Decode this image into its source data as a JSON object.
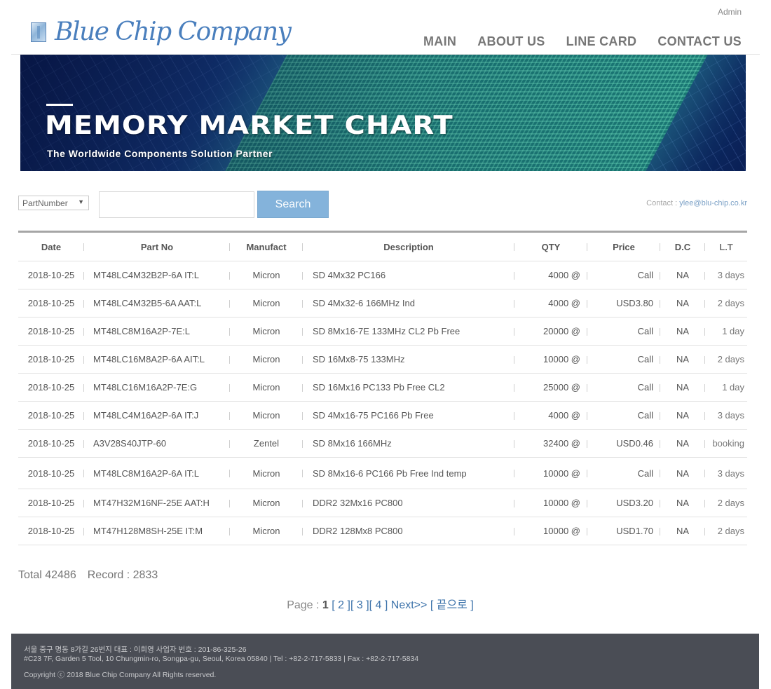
{
  "header": {
    "admin": "Admin",
    "logo_text": "Blue Chip Company",
    "nav": [
      "MAIN",
      "ABOUT US",
      "LINE CARD",
      "CONTACT US"
    ]
  },
  "banner": {
    "title": "MEMORY MARKET CHART",
    "subtitle": "The Worldwide Components Solution Partner"
  },
  "search": {
    "select_value": "PartNumber",
    "input_value": "",
    "button_label": "Search",
    "contact_label": "Contact : ",
    "contact_email": "ylee@blu-chip.co.kr"
  },
  "table": {
    "headers": [
      "Date",
      "Part No",
      "Manufact",
      "Description",
      "QTY",
      "Price",
      "D.C",
      "L.T"
    ],
    "rows": [
      [
        "2018-10-25",
        "MT48LC4M32B2P-6A IT:L",
        "Micron",
        "SD 4Mx32 PC166",
        "4000 @",
        "Call",
        "NA",
        "3 days"
      ],
      [
        "2018-10-25",
        "MT48LC4M32B5-6A AAT:L",
        "Micron",
        "SD 4Mx32-6 166MHz Ind",
        "4000 @",
        "USD3.80",
        "NA",
        "2 days"
      ],
      [
        "2018-10-25",
        "MT48LC8M16A2P-7E:L",
        "Micron",
        "SD 8Mx16-7E 133MHz CL2 Pb Free",
        "20000 @",
        "Call",
        "NA",
        "1 day"
      ],
      [
        "2018-10-25",
        "MT48LC16M8A2P-6A AIT:L",
        "Micron",
        "SD 16Mx8-75 133MHz",
        "10000 @",
        "Call",
        "NA",
        "2 days"
      ],
      [
        "2018-10-25",
        "MT48LC16M16A2P-7E:G",
        "Micron",
        "SD 16Mx16 PC133 Pb Free CL2",
        "25000 @",
        "Call",
        "NA",
        "1 day"
      ],
      [
        "2018-10-25",
        "MT48LC4M16A2P-6A IT:J",
        "Micron",
        "SD 4Mx16-75 PC166 Pb Free",
        "4000 @",
        "Call",
        "NA",
        "3 days"
      ],
      [
        "2018-10-25",
        "A3V28S40JTP-60",
        "Zentel",
        "SD 8Mx16 166MHz",
        "32400 @",
        "USD0.46",
        "NA",
        "booking"
      ],
      [
        "2018-10-25",
        "MT48LC8M16A2P-6A IT:L",
        "Micron",
        "SD 8Mx16-6 PC166 Pb Free Ind temp",
        "10000 @",
        "Call",
        "NA",
        "3 days"
      ],
      [
        "2018-10-25",
        "MT47H32M16NF-25E AAT:H",
        "Micron",
        "DDR2 32Mx16 PC800",
        "10000 @",
        "USD3.20",
        "NA",
        "2 days"
      ],
      [
        "2018-10-25",
        "MT47H128M8SH-25E IT:M",
        "Micron",
        "DDR2 128Mx8 PC800",
        "10000 @",
        "USD1.70",
        "NA",
        "2 days"
      ]
    ]
  },
  "summary": {
    "total": "Total 42486",
    "record": "Record : 2833"
  },
  "paging": {
    "label": "Page : ",
    "current": "1",
    "pages": [
      "[ 2 ]",
      "[ 3 ]",
      "[ 4 ]"
    ],
    "next": "Next>>",
    "last": "[ 끝으로 ]"
  },
  "footer": {
    "line1": "서울 중구 명동 8가길 26번지 대표 : 이희영 사업자 번호 : 201-86-325-26",
    "line2": "#C23 7F, Garden 5 Tool, 10 Chungmin-ro, Songpa-gu, Seoul, Korea 05840 | Tel : +82-2-717-5833 | Fax : +82-2-717-5834",
    "copyright": "Copyright ⓒ 2018 Blue Chip Company All Rights reserved."
  }
}
